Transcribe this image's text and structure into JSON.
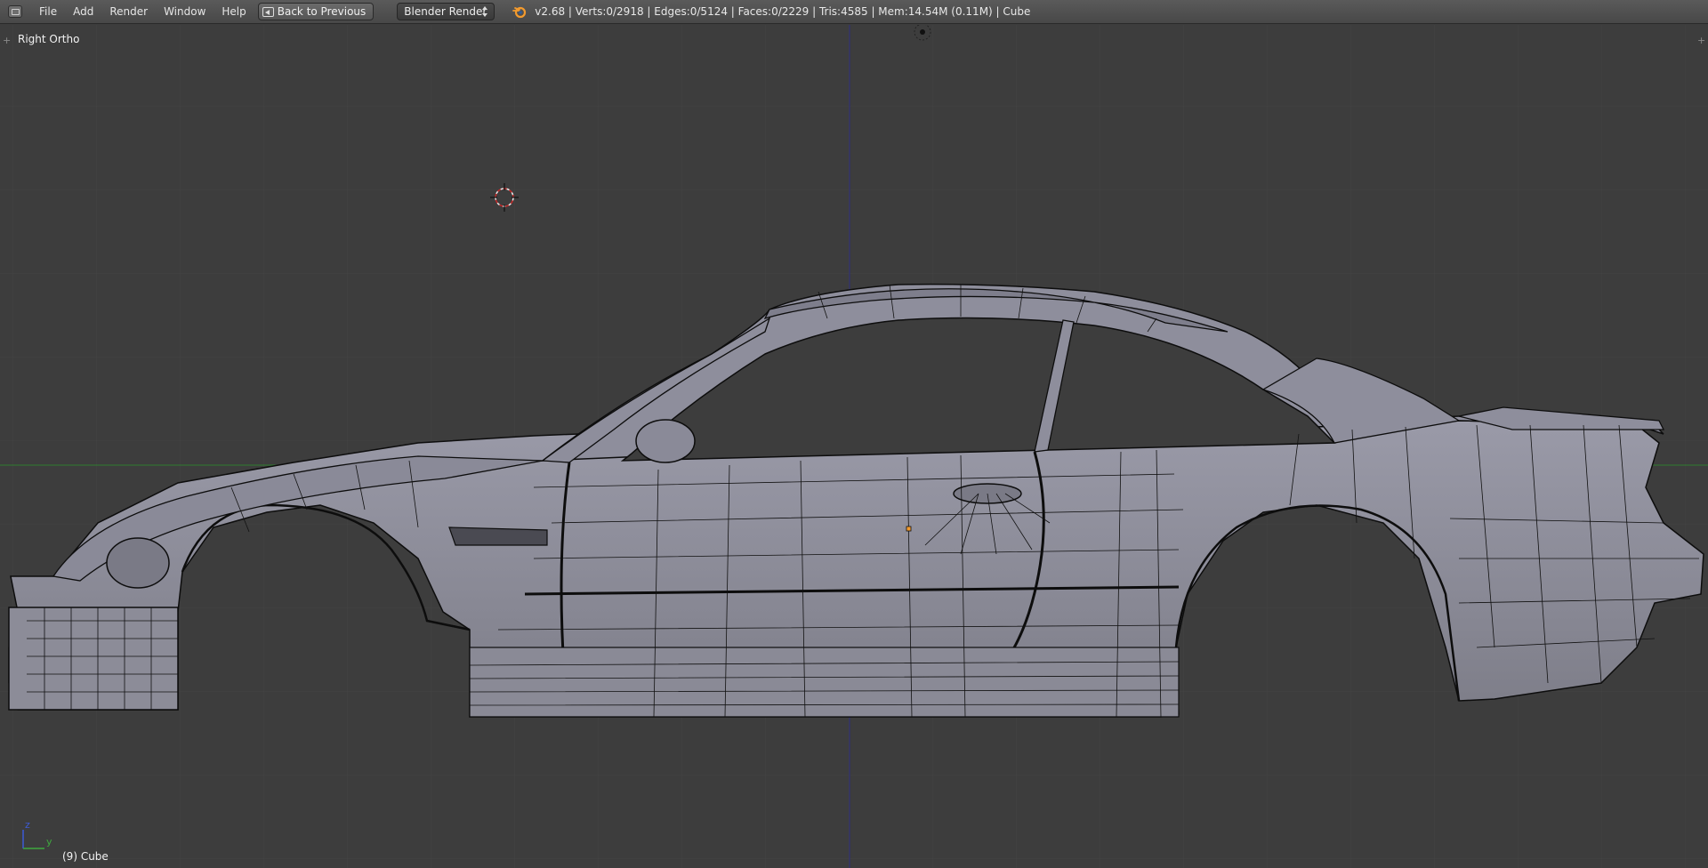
{
  "topbar": {
    "menus": [
      {
        "label": "File"
      },
      {
        "label": "Add"
      },
      {
        "label": "Render"
      },
      {
        "label": "Window"
      },
      {
        "label": "Help"
      }
    ],
    "back_button_label": "Back to Previous",
    "render_engine": "Blender Render",
    "stats_text": "v2.68 | Verts:0/2918 | Edges:0/5124 | Faces:0/2229 | Tris:4585 | Mem:14.54M (0.11M) | Cube"
  },
  "viewport": {
    "view_label": "Right Ortho",
    "object_label": "(9) Cube",
    "axis_labels": {
      "z": "z",
      "y": "y"
    },
    "background_color": "#3d3d3d",
    "grid_color": "#464646",
    "x_axis_color": "#2f7d2f",
    "z_axis_color": "#2b2b7a",
    "mesh_fill_color": "#8c8c9a",
    "wire_color": "#0d0d0d"
  },
  "icons": {
    "editor_type": "3d-view-editor-icon",
    "back": "back-arrow-icon",
    "engine_logo": "blender-logo-icon",
    "cursor": "3d-cursor-icon",
    "lamp": "lamp-icon",
    "origin": "object-origin-icon"
  }
}
